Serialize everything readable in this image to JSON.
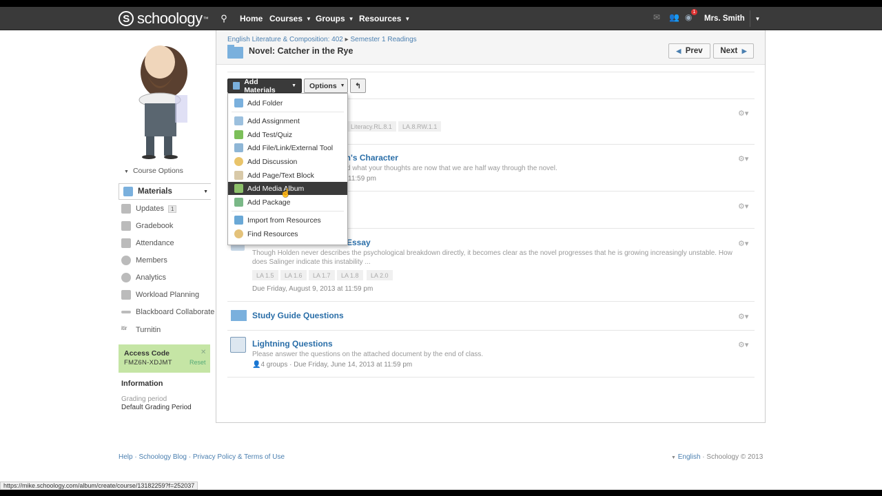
{
  "topbar": {
    "logo": "schoology",
    "nav": [
      {
        "label": "Home",
        "caret": false
      },
      {
        "label": "Courses",
        "caret": true
      },
      {
        "label": "Groups",
        "caret": true
      },
      {
        "label": "Resources",
        "caret": true
      }
    ],
    "notification_count": "1",
    "user_name": "Mrs. Smith"
  },
  "sidebar": {
    "course_options": "Course Options",
    "materials": "Materials",
    "items": [
      {
        "label": "Updates",
        "count": "1"
      },
      {
        "label": "Gradebook"
      },
      {
        "label": "Attendance"
      },
      {
        "label": "Members"
      },
      {
        "label": "Analytics"
      },
      {
        "label": "Workload Planning"
      },
      {
        "label": "Blackboard Collaborate"
      },
      {
        "label": "Turnitin"
      }
    ],
    "access": {
      "title": "Access Code",
      "code": "FMZ6N-XDJMT",
      "reset": "Reset"
    },
    "info": {
      "title": "Information",
      "grading_period_label": "Grading period",
      "grading_period_value": "Default Grading Period"
    }
  },
  "header": {
    "breadcrumb_course": "English Literature & Composition: 402",
    "breadcrumb_sep": "▸",
    "breadcrumb_folder": "Semester 1 Readings",
    "title": "Novel: Catcher in the Rye",
    "prev": "Prev",
    "next": "Next"
  },
  "toolbar": {
    "add_materials": "Add Materials",
    "options": "Options"
  },
  "dropdown": {
    "items": [
      {
        "label": "Add Folder",
        "color": "#7ab0dd"
      },
      {
        "label": "Add Assignment",
        "color": "#9cc0de"
      },
      {
        "label": "Add Test/Quiz",
        "color": "#7cbf5a"
      },
      {
        "label": "Add File/Link/External Tool",
        "color": "#8eb6d6"
      },
      {
        "label": "Add Discussion",
        "color": "#e9c46a"
      },
      {
        "label": "Add Page/Text Block",
        "color": "#d8c9a8"
      },
      {
        "label": "Add Media Album",
        "color": "#8cc06a"
      },
      {
        "label": "Add Package",
        "color": "#7ab887"
      },
      {
        "label": "Import from Resources",
        "color": "#6aa8d6"
      },
      {
        "label": "Find Resources",
        "color": "#e4c27a"
      }
    ],
    "active_index": 6
  },
  "content": {
    "items": [
      {
        "tags": [
          "Literacy.RL.8.1",
          "LA.8.RW.1.1"
        ]
      },
      {
        "title_partial": "en's Character",
        "desc_partial": "d what your thoughts are now that we are half way through the novel.",
        "due_partial": "11:59 pm"
      },
      {},
      {
        "title_partial": "Essay",
        "desc": "Though Holden never describes the psychological breakdown directly, it becomes clear as the novel progresses that he is growing increasingly unstable. How does Salinger indicate this instability ...",
        "tags": [
          "LA 1.5",
          "LA 1.6",
          "LA 1.7",
          "LA 1.8",
          "LA 2.0"
        ],
        "due": "Due Friday, August 9, 2013 at 11:59 pm"
      },
      {
        "title": "Study Guide Questions"
      },
      {
        "title": "Lightning Questions",
        "desc": "Please answer the questions on the attached document by the end of class.",
        "groups": "4 groups",
        "due": " · Due Friday, June 14, 2013 at 11:59 pm"
      }
    ]
  },
  "footer": {
    "links": "Help · Schoology Blog · Privacy Policy & Terms of Use",
    "lang": "English",
    "copyright": " · Schoology © 2013"
  },
  "status_url": "https://mike.schoology.com/album/create/course/13182259?f=252037"
}
